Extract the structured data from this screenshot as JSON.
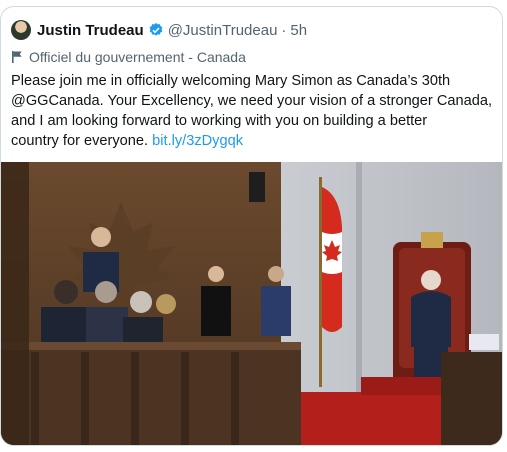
{
  "tweet": {
    "display_name": "Justin Trudeau",
    "handle": "@JustinTrudeau",
    "separator": "·",
    "time": "5h",
    "label": "Officiel du gouvernement - Canada",
    "text_lines": [
      "Please join me in officially welcoming Mary Simon as Canada’s 30th",
      "@GGCanada. Your Excellency, we need your vision of a stronger Canada,",
      "and I am looking forward to working with you on building a better",
      "country for everyone."
    ],
    "link_text": "bit.ly/3zDygqk",
    "icons": {
      "verified": "verified-badge-icon",
      "label": "flag-icon"
    },
    "colors": {
      "text": "#0f1419",
      "secondary": "#536471",
      "link": "#1d9bf0"
    }
  }
}
